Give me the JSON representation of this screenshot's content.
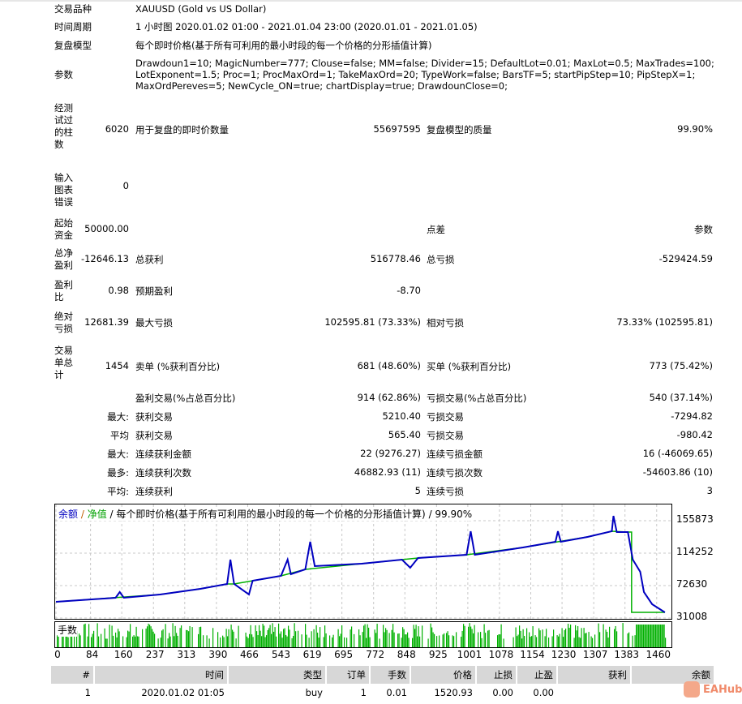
{
  "report": {
    "symbol": {
      "label": "交易品种",
      "value": "XAUUSD (Gold vs US Dollar)"
    },
    "period": {
      "label": "时间周期",
      "value": "1 小时图 2020.01.02 01:00 - 2021.01.04 23:00 (2020.01.01 - 2021.01.05)"
    },
    "model": {
      "label": "复盘模型",
      "value": "每个即时价格(基于所有可利用的最小时段的每一个价格的分形插值计算)"
    },
    "params": {
      "label": "参数",
      "lines": [
        "Drawdoun1=10; MagicNumber=777; Clouse=false; MM=false; Divider=15; DefaultLot=0.01; MaxLot=0.5; MaxTrades=100;",
        "LotExponent=1.5; Proc=1; ProcMaxOrd=1; TakeMaxOrd=20; TypeWork=false; BarsTF=5; startPipStep=10; PipStepX=1;",
        "MaxOrdPereves=5; NewCycle_ON=true; chartDisplay=true; DrawdounClose=0;"
      ]
    },
    "rows": [
      {
        "l1": "经测试过的柱数",
        "v1": "6020",
        "l2": "用于复盘的即时价数量",
        "v2": "55697595",
        "l3": "复盘模型的质量",
        "v3": "99.90%"
      },
      {
        "l1": "输入图表错误",
        "v1": "0",
        "l2": "",
        "v2": "",
        "l3": "",
        "v3": ""
      },
      {
        "l1": "起始资金",
        "v1": "50000.00",
        "l2": "",
        "v2": "",
        "l3": "点差",
        "v3": "参数"
      },
      {
        "l1": "总净盈利",
        "v1": "-12646.13",
        "l2": "总获利",
        "v2": "516778.46",
        "l3": "总亏损",
        "v3": "-529424.59"
      },
      {
        "l1": "盈利比",
        "v1": "0.98",
        "l2": "预期盈利",
        "v2": "-8.70",
        "l3": "",
        "v3": ""
      },
      {
        "l1": "绝对亏损",
        "v1": "12681.39",
        "l2": "最大亏损",
        "v2": "102595.81 (73.33%)",
        "l3": "相对亏损",
        "v3": "73.33% (102595.81)"
      },
      {
        "l1": "交易单总计",
        "v1": "1454",
        "l2": "卖单 (%获利百分比)",
        "v2": "681 (48.60%)",
        "l3": "买单 (%获利百分比)",
        "v3": "773 (75.42%)"
      },
      {
        "l1": "",
        "v1": "",
        "l2": "盈利交易(%占总百分比)",
        "v2": "914 (62.86%)",
        "l3": "亏损交易(%占总百分比)",
        "v3": "540 (37.14%)"
      },
      {
        "l1": "",
        "v1": "最大:",
        "l2": "获利交易",
        "v2": "5210.40",
        "l3": "亏损交易",
        "v3": "-7294.82"
      },
      {
        "l1": "",
        "v1": "平均",
        "l2": "获利交易",
        "v2": "565.40",
        "l3": "亏损交易",
        "v3": "-980.42"
      },
      {
        "l1": "",
        "v1": "最大:",
        "l2": "连续获利金额",
        "v2": "22 (9276.27)",
        "l3": "连续亏损金额",
        "v3": "16 (-46069.65)"
      },
      {
        "l1": "",
        "v1": "最多:",
        "l2": "连续获利次数",
        "v2": "46882.93 (11)",
        "l3": "连续亏损次数",
        "v3": "-54603.86 (10)"
      },
      {
        "l1": "",
        "v1": "平均:",
        "l2": "连续获利",
        "v2": "5",
        "l3": "连续亏损",
        "v3": "3"
      }
    ]
  },
  "chart_data": {
    "type": "line",
    "legend": {
      "balance": "余额",
      "sep1": " / ",
      "equity": "净值",
      "sep2": " / ",
      "model": "每个即时价格(基于所有可利用的最小时段的每一个价格的分形插值计算)",
      "sep3": " / ",
      "quality": "99.90%"
    },
    "lots_label": "手数",
    "colors": {
      "balance": "#0000c0",
      "equity": "#00b000",
      "lots": "#00b000"
    },
    "ylim": [
      31008,
      170000
    ],
    "xlim": [
      0,
      1490
    ],
    "yticks": [
      "155873",
      "114252",
      "72630",
      "31008"
    ],
    "ytick_values": [
      155873,
      114252,
      72630,
      31008
    ],
    "xticks": [
      "0",
      "84",
      "160",
      "237",
      "313",
      "390",
      "466",
      "543",
      "619",
      "695",
      "772",
      "848",
      "925",
      "1001",
      "1078",
      "1154",
      "1230",
      "1307",
      "1383",
      "1460"
    ],
    "balance": [
      [
        0,
        51800
      ],
      [
        145,
        57000
      ],
      [
        155,
        64300
      ],
      [
        165,
        57000
      ],
      [
        253,
        61200
      ],
      [
        351,
        68450
      ],
      [
        416,
        74700
      ],
      [
        424,
        105900
      ],
      [
        433,
        74700
      ],
      [
        469,
        61200
      ],
      [
        478,
        78850
      ],
      [
        547,
        85100
      ],
      [
        563,
        105900
      ],
      [
        571,
        87200
      ],
      [
        606,
        93400
      ],
      [
        618,
        128800
      ],
      [
        629,
        97600
      ],
      [
        743,
        100700
      ],
      [
        841,
        105900
      ],
      [
        861,
        95500
      ],
      [
        880,
        108000
      ],
      [
        998,
        112100
      ],
      [
        1008,
        142300
      ],
      [
        1018,
        112100
      ],
      [
        1135,
        121500
      ],
      [
        1214,
        128800
      ],
      [
        1220,
        142300
      ],
      [
        1227,
        128800
      ],
      [
        1292,
        135000
      ],
      [
        1351,
        142300
      ],
      [
        1355,
        162000
      ],
      [
        1363,
        141200
      ],
      [
        1390,
        141200
      ],
      [
        1402,
        105900
      ],
      [
        1420,
        90300
      ],
      [
        1429,
        64300
      ],
      [
        1449,
        48700
      ],
      [
        1480,
        38300
      ]
    ],
    "equity": [
      [
        0,
        51800
      ],
      [
        253,
        61200
      ],
      [
        351,
        68450
      ],
      [
        416,
        74700
      ],
      [
        433,
        74700
      ],
      [
        547,
        85100
      ],
      [
        606,
        93400
      ],
      [
        743,
        100700
      ],
      [
        841,
        105900
      ],
      [
        880,
        108000
      ],
      [
        998,
        112100
      ],
      [
        1135,
        121500
      ],
      [
        1292,
        135000
      ],
      [
        1351,
        142300
      ],
      [
        1390,
        141200
      ],
      [
        1399,
        141200
      ],
      [
        1399,
        38300
      ],
      [
        1480,
        38300
      ]
    ]
  },
  "trades": {
    "headers": [
      "#",
      "时间",
      "类型",
      "订单",
      "手数",
      "价格",
      "止损",
      "止盈",
      "获利",
      "余额"
    ],
    "rows": [
      [
        "1",
        "2020.01.02 01:05",
        "buy",
        "1",
        "0.01",
        "1520.93",
        "0.00",
        "0.00",
        "",
        ""
      ]
    ]
  },
  "watermark": "EAHub"
}
